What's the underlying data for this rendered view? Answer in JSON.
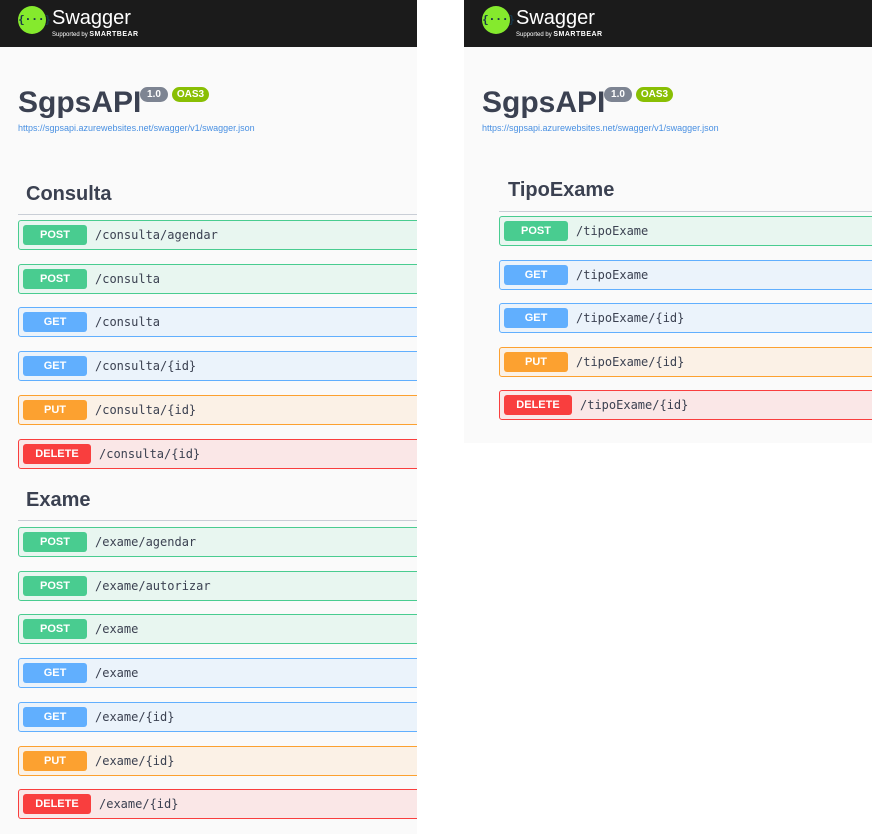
{
  "left": {
    "brand": {
      "name": "Swagger",
      "supported_by": "Supported by",
      "company": "SMARTBEAR",
      "logo_glyph": "{···}"
    },
    "api": {
      "title": "SgpsAPI",
      "version": "1.0",
      "oas": "OAS3",
      "url": "https://sgpsapi.azurewebsites.net/swagger/v1/swagger.json"
    },
    "sections": [
      {
        "title": "Consulta",
        "operations": [
          {
            "method": "POST",
            "path": "/consulta/agendar"
          },
          {
            "method": "POST",
            "path": "/consulta"
          },
          {
            "method": "GET",
            "path": "/consulta"
          },
          {
            "method": "GET",
            "path": "/consulta/{id}"
          },
          {
            "method": "PUT",
            "path": "/consulta/{id}"
          },
          {
            "method": "DELETE",
            "path": "/consulta/{id}"
          }
        ]
      },
      {
        "title": "Exame",
        "operations": [
          {
            "method": "POST",
            "path": "/exame/agendar"
          },
          {
            "method": "POST",
            "path": "/exame/autorizar"
          },
          {
            "method": "POST",
            "path": "/exame"
          },
          {
            "method": "GET",
            "path": "/exame"
          },
          {
            "method": "GET",
            "path": "/exame/{id}"
          },
          {
            "method": "PUT",
            "path": "/exame/{id}"
          },
          {
            "method": "DELETE",
            "path": "/exame/{id}"
          }
        ]
      }
    ]
  },
  "right": {
    "brand": {
      "name": "Swagger",
      "supported_by": "Supported by",
      "company": "SMARTBEAR",
      "logo_glyph": "{···}"
    },
    "api": {
      "title": "SgpsAPI",
      "version": "1.0",
      "oas": "OAS3",
      "url": "https://sgpsapi.azurewebsites.net/swagger/v1/swagger.json"
    },
    "sections": [
      {
        "title": "TipoExame",
        "operations": [
          {
            "method": "POST",
            "path": "/tipoExame"
          },
          {
            "method": "GET",
            "path": "/tipoExame"
          },
          {
            "method": "GET",
            "path": "/tipoExame/{id}"
          },
          {
            "method": "PUT",
            "path": "/tipoExame/{id}"
          },
          {
            "method": "DELETE",
            "path": "/tipoExame/{id}"
          }
        ]
      }
    ]
  },
  "colors": {
    "post": "#49cc90",
    "get": "#61affe",
    "put": "#fca130",
    "delete": "#f93e3e",
    "brand_green": "#85ea2d",
    "topbar": "#1b1b1b"
  }
}
